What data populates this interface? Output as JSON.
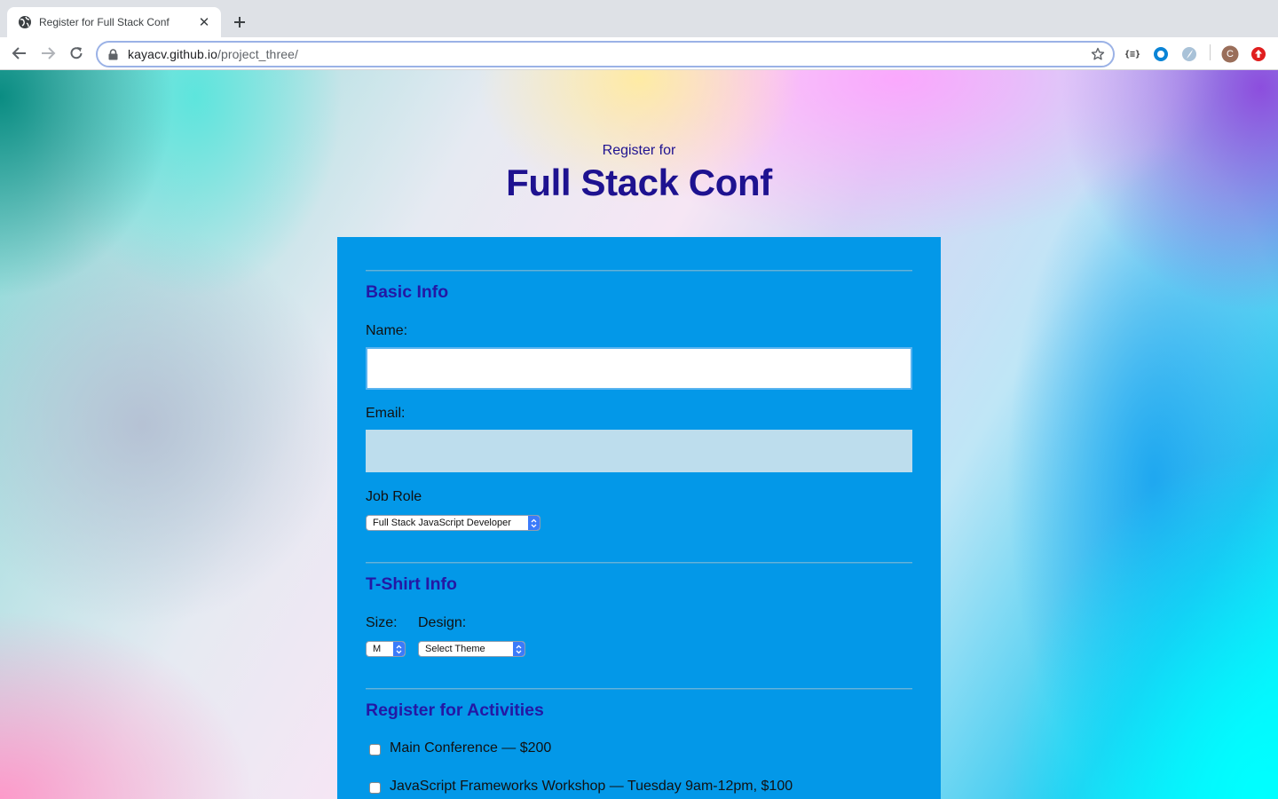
{
  "browser": {
    "tab_title": "Register for Full Stack Conf",
    "url_host": "kayacv.github.io",
    "url_path": "/project_three/",
    "icons": {
      "favicon": "globe-icon",
      "close": "close-icon",
      "new_tab": "plus-icon",
      "back": "arrow-left-icon",
      "forward": "arrow-right-icon",
      "reload": "reload-icon",
      "lock": "lock-icon",
      "bookmark": "star-icon",
      "extensions": [
        "json-viewer-extension-icon",
        "ring-extension-icon",
        "feather-extension-icon"
      ],
      "profile": "profile-avatar",
      "update": "update-icon"
    },
    "profile_initial": "C",
    "extension_json_label": "{≡}"
  },
  "header": {
    "subtitle": "Register for",
    "title": "Full Stack Conf"
  },
  "form": {
    "basic_info": {
      "heading": "Basic Info",
      "name_label": "Name:",
      "name_value": "",
      "email_label": "Email:",
      "email_value": "",
      "job_role_label": "Job Role",
      "job_role_selected": "Full Stack JavaScript Developer"
    },
    "tshirt": {
      "heading": "T-Shirt Info",
      "size_label": "Size:",
      "size_selected": "M",
      "design_label": "Design:",
      "design_selected": "Select Theme"
    },
    "activities": {
      "heading": "Register for Activities",
      "items": [
        {
          "label": "Main Conference — $200",
          "checked": false
        },
        {
          "label": "JavaScript Frameworks Workshop — Tuesday 9am-12pm, $100",
          "checked": false
        }
      ]
    }
  },
  "colors": {
    "form_background": "#0398e8",
    "heading_color": "#1e1290",
    "section_heading_color": "#2418a4",
    "select_arrow": "#3b7bfa"
  }
}
